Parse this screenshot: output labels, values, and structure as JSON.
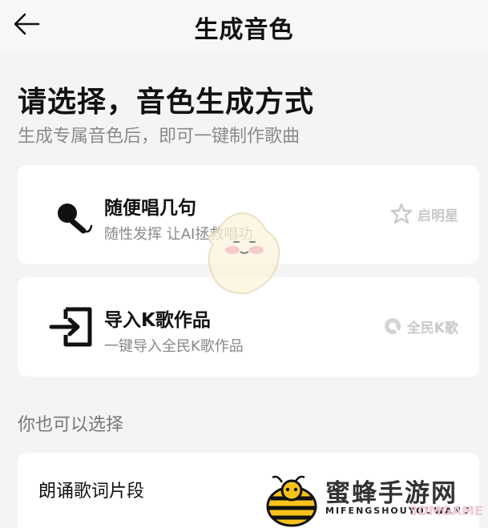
{
  "header": {
    "title": "生成音色",
    "back_icon": "arrow-left-icon"
  },
  "intro": {
    "title": "请选择，音色生成方式",
    "subtitle": "生成专属音色后，即可一键制作歌曲"
  },
  "options": [
    {
      "title": "随便唱几句",
      "description": "随性发挥 让AI拯救唱功",
      "icon": "microphone-icon",
      "brand": "启明星",
      "brand_icon": "star-logo-icon"
    },
    {
      "title": "导入K歌作品",
      "description": "一键导入全民K歌作品",
      "icon": "import-icon",
      "brand": "全民K歌",
      "brand_icon": "kge-logo-icon"
    }
  ],
  "more": {
    "label": "你也可以选择",
    "items": [
      {
        "title": "朗诵歌词片段"
      }
    ]
  },
  "watermark": {
    "main": "蜜蜂手游网",
    "sub": "MIFENGSHOUYOUWANG",
    "badge": "3DMGAME"
  },
  "colors": {
    "background": "#f4f4f4",
    "card": "#ffffff",
    "brand_gray": "#c9c9c9",
    "bee_yellow": "#f7c31b"
  }
}
